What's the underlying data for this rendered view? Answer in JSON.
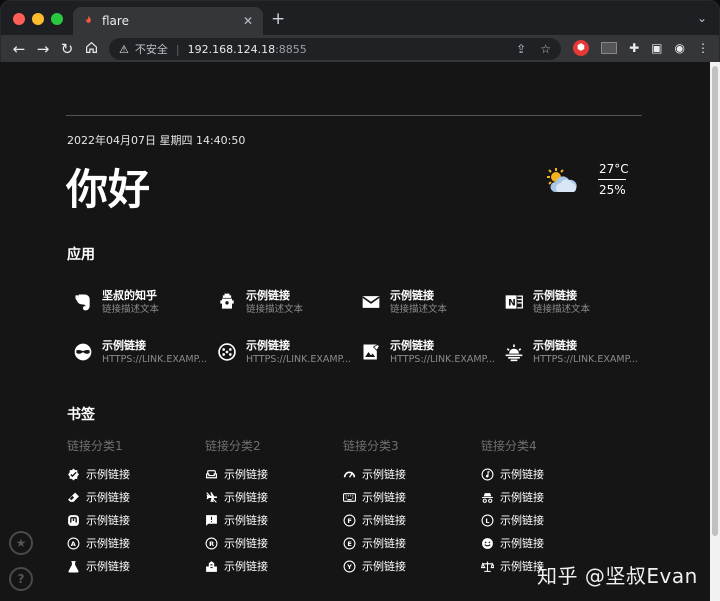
{
  "browser": {
    "tab_title": "flare",
    "security_label": "不安全",
    "url_host": "192.168.124.18",
    "url_port": ":8855",
    "colors": {
      "close": "#ff5f57",
      "minimize": "#febc2e",
      "maximize": "#28c840"
    }
  },
  "header": {
    "datetime": "2022年04月07日 星期四 14:40:50",
    "greeting": "你好"
  },
  "weather": {
    "temperature": "27°C",
    "humidity": "25%",
    "icon": "partly-cloudy-icon"
  },
  "apps_section": {
    "title": "应用",
    "items": [
      {
        "name": "坚叔的知乎",
        "desc": "链接描述文本",
        "icon": "evernote-icon"
      },
      {
        "name": "示例链接",
        "desc": "链接描述文本",
        "icon": "fire-hydrant-icon"
      },
      {
        "name": "示例链接",
        "desc": "链接描述文本",
        "icon": "mail-icon"
      },
      {
        "name": "示例链接",
        "desc": "链接描述文本",
        "icon": "onenote-icon"
      },
      {
        "name": "示例链接",
        "desc": "HTTPS://LINK.EXAMP...",
        "icon": "mask-icon"
      },
      {
        "name": "示例链接",
        "desc": "HTTPS://LINK.EXAMP...",
        "icon": "dots-circle-icon"
      },
      {
        "name": "示例链接",
        "desc": "HTTPS://LINK.EXAMP...",
        "icon": "image-edit-icon"
      },
      {
        "name": "示例链接",
        "desc": "HTTPS://LINK.EXAMP...",
        "icon": "sunset-icon"
      }
    ]
  },
  "bookmarks_section": {
    "title": "书签",
    "categories": [
      {
        "title": "链接分类1",
        "links": [
          {
            "label": "示例链接",
            "icon": "check-decagram-icon"
          },
          {
            "label": "示例链接",
            "icon": "eraser-icon"
          },
          {
            "label": "示例链接",
            "icon": "mastodon-icon"
          },
          {
            "label": "示例链接",
            "icon": "alpha-a-circle-icon"
          },
          {
            "label": "示例链接",
            "icon": "flask-icon"
          }
        ]
      },
      {
        "title": "链接分类2",
        "links": [
          {
            "label": "示例链接",
            "icon": "sofa-icon"
          },
          {
            "label": "示例链接",
            "icon": "airplane-off-icon"
          },
          {
            "label": "示例链接",
            "icon": "message-alert-icon"
          },
          {
            "label": "示例链接",
            "icon": "alpha-r-circle-icon"
          },
          {
            "label": "示例链接",
            "icon": "city-icon"
          }
        ]
      },
      {
        "title": "链接分类3",
        "links": [
          {
            "label": "示例链接",
            "icon": "gauge-icon"
          },
          {
            "label": "示例链接",
            "icon": "keyboard-icon"
          },
          {
            "label": "示例链接",
            "icon": "alpha-f-circle-icon"
          },
          {
            "label": "示例链接",
            "icon": "alpha-e-circle-icon"
          },
          {
            "label": "示例链接",
            "icon": "alpha-y-circle-icon"
          }
        ]
      },
      {
        "title": "链接分类4",
        "links": [
          {
            "label": "示例链接",
            "icon": "music-note-icon"
          },
          {
            "label": "示例链接",
            "icon": "incognito-icon"
          },
          {
            "label": "示例链接",
            "icon": "alpha-l-circle-icon"
          },
          {
            "label": "示例链接",
            "icon": "emoticon-icon"
          },
          {
            "label": "示例链接",
            "icon": "scale-balance-icon"
          }
        ]
      }
    ]
  },
  "watermark": "知乎 @坚叔Evan"
}
